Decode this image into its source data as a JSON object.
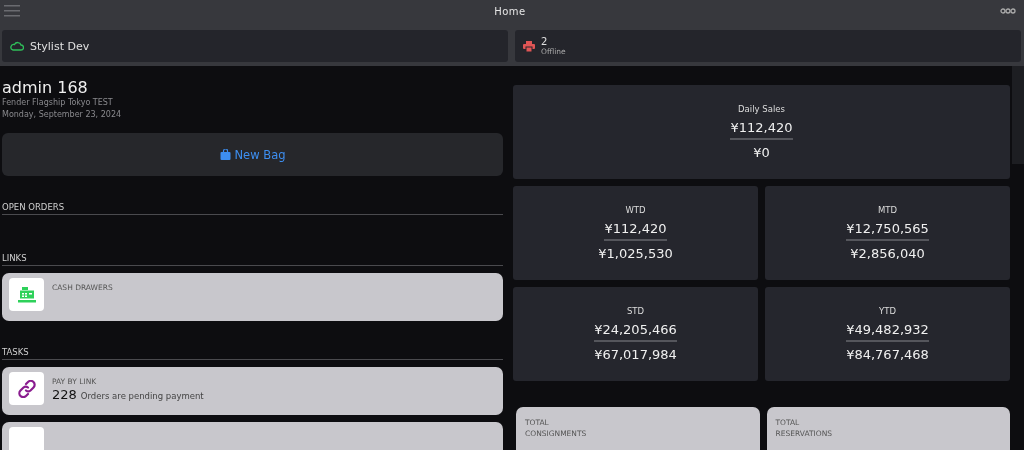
{
  "header": {
    "title": "Home"
  },
  "status": [
    {
      "kind": "cloud",
      "title": "Stylist Dev"
    },
    {
      "kind": "printer",
      "title": "2",
      "subtitle": "Offline"
    }
  ],
  "user": {
    "name": "admin 168",
    "store": "Fender Flagship Tokyo TEST",
    "date": "Monday, September 23, 2024"
  },
  "new_bag": {
    "label": "New Bag"
  },
  "sections": [
    {
      "title": "OPEN ORDERS"
    },
    {
      "title": "LINKS",
      "items": [
        {
          "kind": "register",
          "title": "CASH DRAWERS"
        }
      ]
    },
    {
      "title": "TASKS",
      "items": [
        {
          "kind": "link",
          "title": "PAY BY LINK",
          "count": "228",
          "text": "Orders are pending payment"
        },
        {
          "kind": "blank"
        }
      ]
    }
  ],
  "sales": [
    {
      "title": "Daily Sales",
      "primary": "¥112,420",
      "secondary": "¥0",
      "wide": true
    },
    {
      "title": "WTD",
      "primary": "¥112,420",
      "secondary": "¥1,025,530",
      "wide": false
    },
    {
      "title": "MTD",
      "primary": "¥12,750,565",
      "secondary": "¥2,856,040",
      "wide": false
    },
    {
      "title": "STD",
      "primary": "¥24,205,466",
      "secondary": "¥67,017,984",
      "wide": false
    },
    {
      "title": "YTD",
      "primary": "¥49,482,932",
      "secondary": "¥84,767,468",
      "wide": false
    }
  ],
  "totals": [
    {
      "line1": "TOTAL",
      "line2": "CONSIGNMENTS"
    },
    {
      "line1": "TOTAL",
      "line2": "RESERVATIONS"
    }
  ]
}
